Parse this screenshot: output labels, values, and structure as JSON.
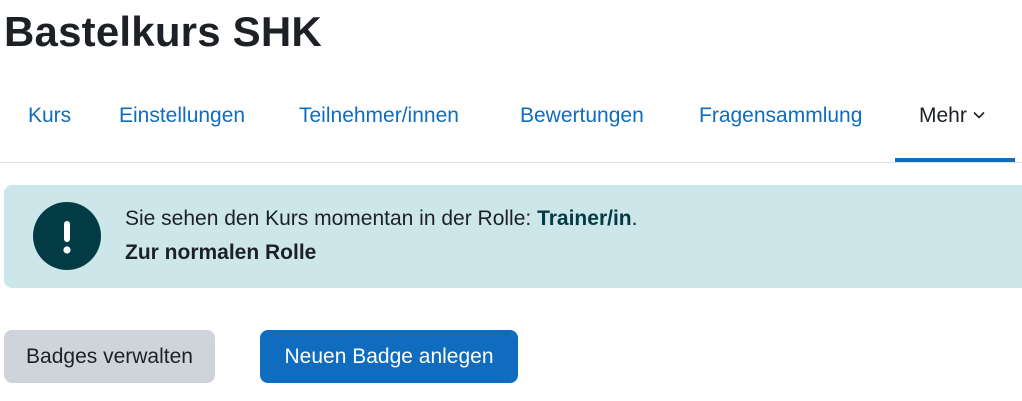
{
  "page": {
    "title": "Bastelkurs SHK"
  },
  "nav": {
    "items": [
      {
        "label": "Kurs"
      },
      {
        "label": "Einstellungen"
      },
      {
        "label": "Teilnehmer/innen"
      },
      {
        "label": "Bewertungen"
      },
      {
        "label": "Fragensammlung"
      },
      {
        "label": "Mehr"
      }
    ]
  },
  "alert": {
    "icon": "exclamation-icon",
    "message_prefix": "Sie sehen den Kurs momentan in der Rolle: ",
    "role": "Trainer/in",
    "message_suffix": ".",
    "link_label": "Zur normalen Rolle"
  },
  "actions": {
    "manage_badges": "Badges verwalten",
    "new_badge": "Neuen Badge anlegen"
  },
  "colors": {
    "primary": "#0f6cbf",
    "alert_bg": "#cce6ea",
    "alert_icon_bg": "#033b45",
    "secondary_button": "#ced4da"
  }
}
